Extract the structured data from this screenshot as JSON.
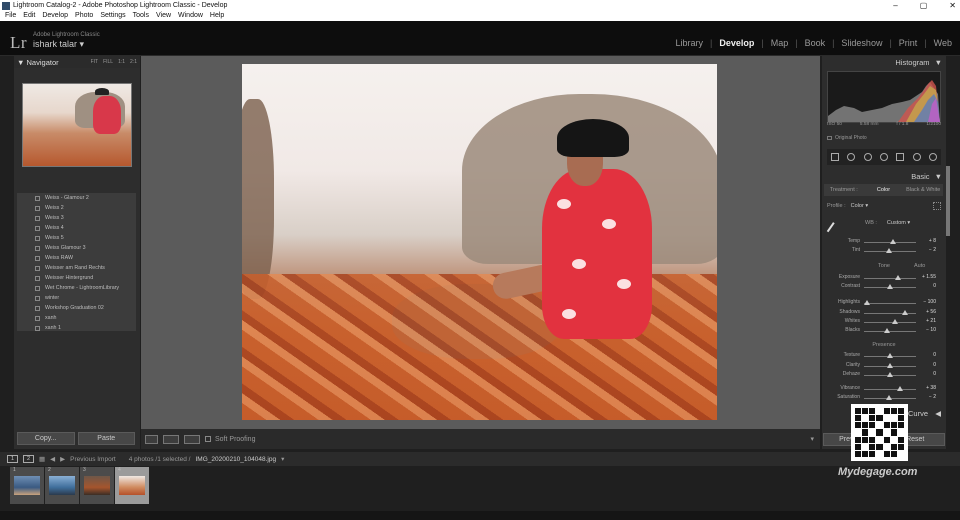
{
  "window": {
    "title": "Lightroom Catalog-2 - Adobe Photoshop Lightroom Classic - Develop"
  },
  "menu": [
    "File",
    "Edit",
    "Develop",
    "Photo",
    "Settings",
    "Tools",
    "View",
    "Window",
    "Help"
  ],
  "identity": {
    "logo": "Lr",
    "app_name": "Adobe Lightroom Classic",
    "user": "ishark talar"
  },
  "modules": [
    "Library",
    "Develop",
    "Map",
    "Book",
    "Slideshow",
    "Print",
    "Web"
  ],
  "active_module": "Develop",
  "navigator": {
    "title": "Navigator",
    "options": [
      "FIT",
      "FILL",
      "1:1",
      "2:1"
    ]
  },
  "presets": [
    "Weiss - Glamour 2",
    "Weiss 2",
    "Weiss 3",
    "Weiss 4",
    "Weiss 5",
    "Weiss Glamour 3",
    "Weiss RAW",
    "Weisser am Rand Rechts",
    "Weisser Hintergrund",
    "Wet Chrome - LightroomLibrary",
    "winter",
    "Workshop Graduation 02",
    "xanh",
    "xanh 1"
  ],
  "left_buttons": {
    "copy": "Copy...",
    "paste": "Paste"
  },
  "toolbar": {
    "soft_proofing": "Soft Proofing"
  },
  "histogram": {
    "title": "Histogram",
    "iso": "ISO 50",
    "focal": "5.58 mm",
    "aperture": "f / 1.8",
    "shutter": "1/2100",
    "original_photo": "Original Photo"
  },
  "basic": {
    "title": "Basic",
    "treatment_label": "Treatment :",
    "treatment_color": "Color",
    "treatment_bw": "Black & White",
    "profile_label": "Profile :",
    "profile_value": "Color",
    "wb_label": "WB :",
    "wb_value": "Custom",
    "tone_title": "Tone",
    "auto": "Auto",
    "presence_title": "Presence",
    "curve_title": "Curve"
  },
  "sliders": [
    {
      "label": "Temp",
      "value": "+ 8",
      "pos": 0.55
    },
    {
      "label": "Tint",
      "value": "− 2",
      "pos": 0.48
    },
    {
      "label": "Exposure",
      "value": "+ 1.55",
      "pos": 0.65
    },
    {
      "label": "Contrast",
      "value": "0",
      "pos": 0.5
    },
    {
      "label": "Highlights",
      "value": "− 100",
      "pos": 0.05
    },
    {
      "label": "Shadows",
      "value": "+ 56",
      "pos": 0.78
    },
    {
      "label": "Whites",
      "value": "+ 21",
      "pos": 0.6
    },
    {
      "label": "Blacks",
      "value": "− 10",
      "pos": 0.45
    },
    {
      "label": "Texture",
      "value": "0",
      "pos": 0.5
    },
    {
      "label": "Clarity",
      "value": "0",
      "pos": 0.5
    },
    {
      "label": "Dehaze",
      "value": "0",
      "pos": 0.5
    },
    {
      "label": "Vibrance",
      "value": "+ 38",
      "pos": 0.69
    },
    {
      "label": "Saturation",
      "value": "− 2",
      "pos": 0.49
    }
  ],
  "filmstrip": {
    "pages": [
      "1",
      "2"
    ],
    "source": "Previous Import",
    "info": "4 photos /1 selected /",
    "filename": "IMG_20200210_104048.jpg",
    "thumb_numbers": [
      "1",
      "2",
      "3",
      "4"
    ]
  },
  "watermark": "Mydegage.com",
  "right_buttons": {
    "previous": "Previous",
    "reset": "Reset"
  }
}
